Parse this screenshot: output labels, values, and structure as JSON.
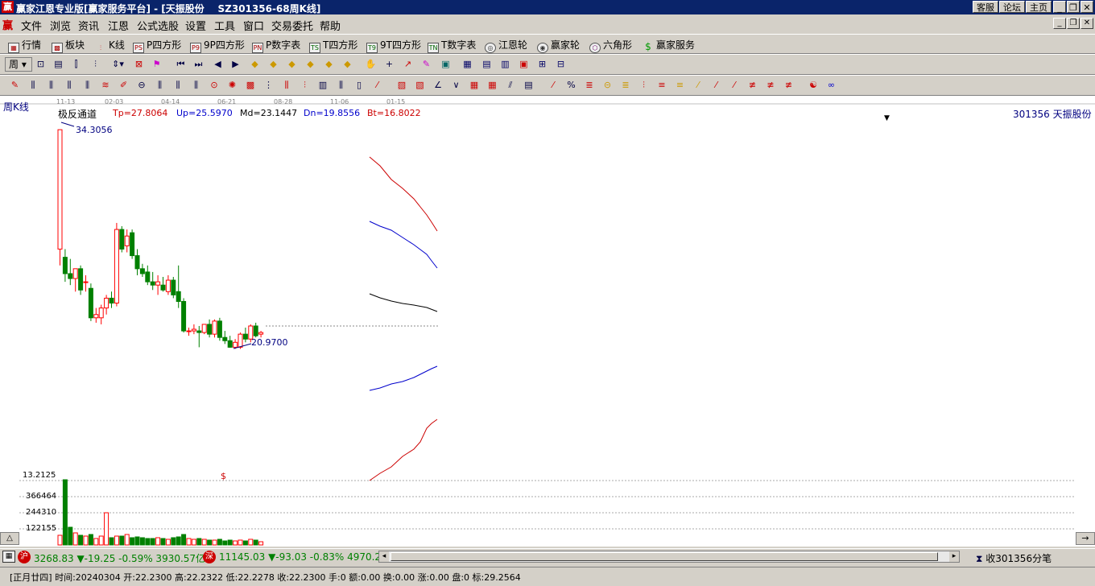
{
  "window": {
    "logo": "赢",
    "title": "赢家江恩专业版[赢家服务平台] - [天振股份    SZ301356-68周K线]",
    "links": [
      "客服",
      "论坛",
      "主页"
    ]
  },
  "menu": {
    "logo": "赢",
    "items": [
      "文件",
      "浏览",
      "资讯",
      "江恩",
      "公式选股",
      "设置",
      "工具",
      "窗口",
      "交易委托",
      "帮助"
    ]
  },
  "toolbar1": {
    "items": [
      {
        "label": "行情",
        "icon": "grid-table-icon"
      },
      {
        "label": "板块",
        "icon": "block-icon"
      },
      {
        "label": "K线",
        "icon": "candlestick-icon"
      },
      {
        "label": "P四方形",
        "icon": "ps-icon"
      },
      {
        "label": "9P四方形",
        "icon": "p9-icon"
      },
      {
        "label": "P数字表",
        "icon": "pn-icon"
      },
      {
        "label": "T四方形",
        "icon": "ts-icon"
      },
      {
        "label": "9T四方形",
        "icon": "t9-icon"
      },
      {
        "label": "T数字表",
        "icon": "tn-icon"
      },
      {
        "label": "江恩轮",
        "icon": "wheel-icon"
      },
      {
        "label": "赢家轮",
        "icon": "winner-wheel-icon"
      },
      {
        "label": "六角形",
        "icon": "hexagon-icon"
      },
      {
        "label": "赢家服务",
        "icon": "dollar-icon"
      }
    ]
  },
  "toolbar2": {
    "period": "周"
  },
  "chart": {
    "period_label": "周K线",
    "dates": [
      "11-13",
      "02-03",
      "04-14",
      "06-21",
      "08-28",
      "11-06",
      "01-15"
    ],
    "indicator": {
      "name": "极反通道",
      "tp": "Tp=27.8064",
      "up": "Up=25.5970",
      "md": "Md=23.1447",
      "dn": "Dn=19.8556",
      "bt": "Bt=16.8022"
    },
    "stock": "301356 天振股份",
    "high_label": "34.3056",
    "low_label": "20.9700",
    "volume_marker": "$",
    "volume_axis": [
      "13.2125",
      "366464",
      "244310",
      "122155"
    ],
    "colors": {
      "up": "#ff0000",
      "down": "#008000",
      "tp": "#cc0000",
      "upper": "#0000cc",
      "mid": "#000000",
      "lower": "#0000cc",
      "bottom": "#cc0000"
    }
  },
  "statusbar": {
    "sh_icon": "沪",
    "sh_text": "3268.83 ▼-19.25 -0.59% 3930.57亿",
    "sz_icon": "深",
    "sz_text": "11145.03 ▼-93.03 -0.83% 4970.2",
    "right_text": "收301356分笔"
  },
  "infobar": {
    "text": "[正月廿四] 时间:20240304 开:22.2300 高:22.2322 低:22.2278 收:22.2300 手:0 额:0.00 换:0.00 涨:0.00 盘:0 标:29.2564"
  }
}
